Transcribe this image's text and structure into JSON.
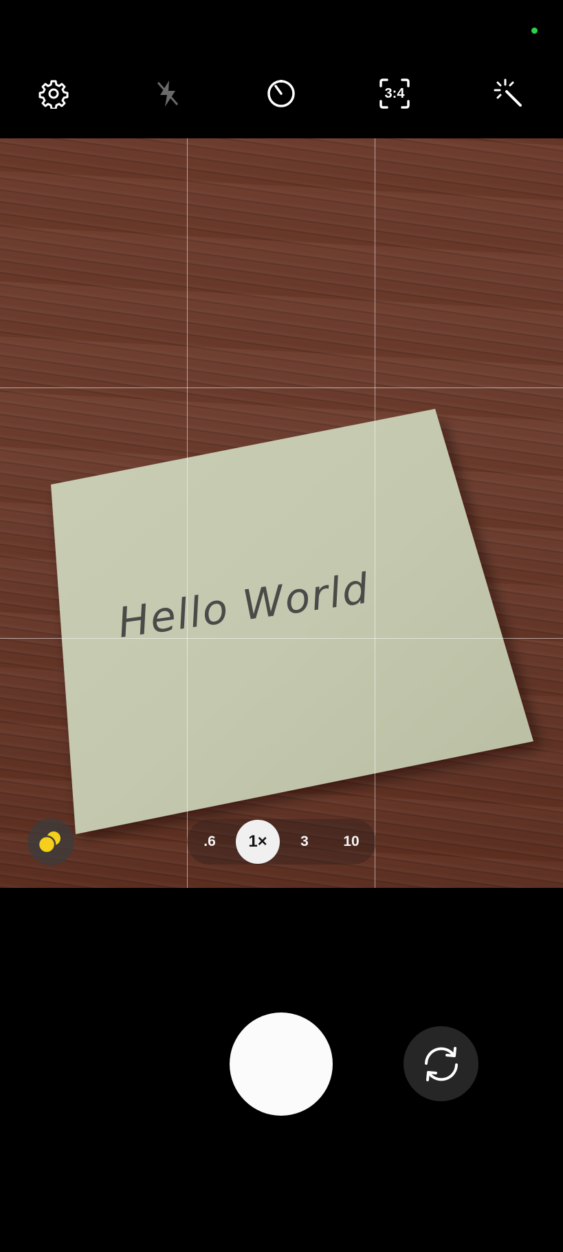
{
  "status": {
    "indicator_color": "#2bd24a"
  },
  "top_bar": {
    "settings_icon": "gear-icon",
    "flash_icon": "flash-off-icon",
    "timer_icon": "timer-icon",
    "ratio_label": "3:4",
    "effects_icon": "magic-wand-icon"
  },
  "viewfinder": {
    "note_text": "Hello World",
    "grid": true
  },
  "zoom": {
    "options": [
      ".6",
      "1×",
      "3",
      "10"
    ],
    "selected": "1×"
  },
  "mode_icon": "filters-icon",
  "shutter_icon": "shutter-button",
  "switch_camera_icon": "switch-camera-icon",
  "colors": {
    "accent_yellow": "#f6cf1a",
    "shutter": "#fbfbfb",
    "background": "#000000"
  }
}
